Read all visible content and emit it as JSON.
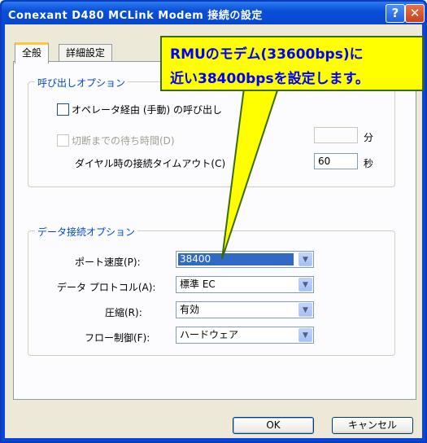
{
  "window": {
    "title": "Conexant D480 MCLink Modem 接続の設定",
    "help_label": "?",
    "close_label": "✕"
  },
  "tabs": [
    {
      "label": "全般",
      "selected": true
    },
    {
      "label": "詳細設定",
      "selected": false
    }
  ],
  "call_options": {
    "legend": "呼び出しオプション",
    "operator_assisted_label": "オペレータ経由 (手動) の呼び出し",
    "wait_before_disconnect_label": "切断までの待ち時間(D)",
    "wait_before_disconnect_value": "",
    "wait_unit": "分",
    "dial_timeout_label": "ダイヤル時の接続タイムアウト(C)",
    "dial_timeout_value": "60",
    "dial_timeout_unit": "秒"
  },
  "data_options": {
    "legend": "データ接続オプション",
    "fields": [
      {
        "label": "ポート速度(P):",
        "value": "38400"
      },
      {
        "label": "データ プロトコル(A):",
        "value": "標準 EC"
      },
      {
        "label": "圧縮(R):",
        "value": "有効"
      },
      {
        "label": "フロー制御(F):",
        "value": "ハードウェア"
      }
    ]
  },
  "buttons": {
    "ok_label": "OK",
    "cancel_label": "キャンセル"
  },
  "annotation": {
    "line1": "RMUのモデム(33600bps)に",
    "line2": "近い38400bpsを設定します。",
    "fill": "#ffff00",
    "text_color": "#0000ff"
  }
}
